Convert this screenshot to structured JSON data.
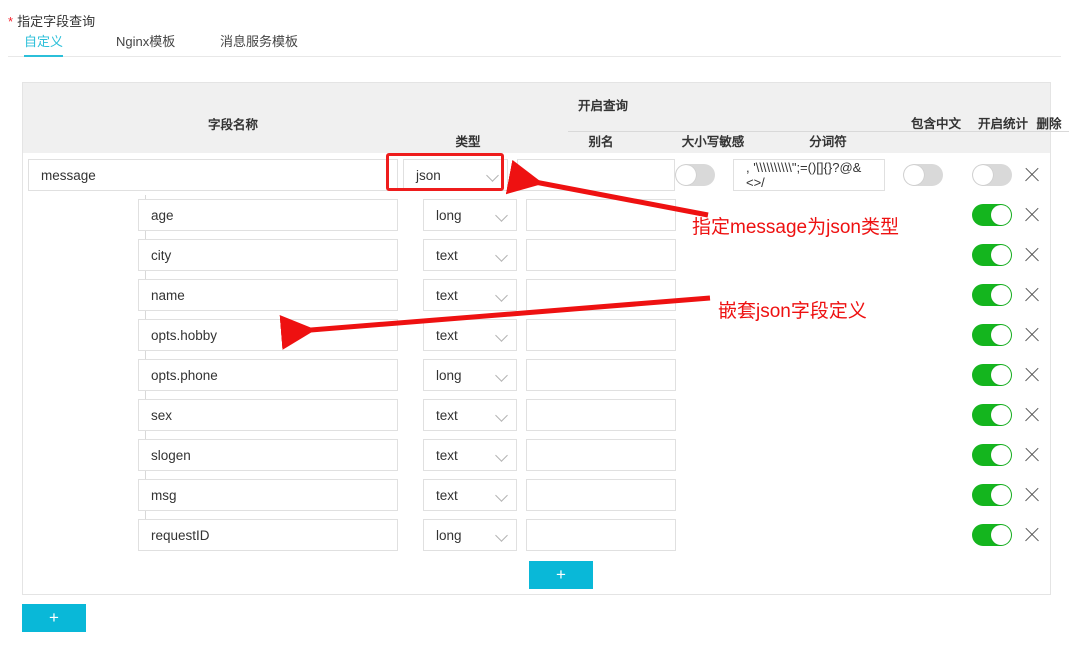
{
  "form": {
    "required_marker": "*",
    "label": "指定字段查询"
  },
  "tabs": [
    {
      "label": "自定义",
      "active": true
    },
    {
      "label": "Nginx模板",
      "active": false
    },
    {
      "label": "消息服务模板",
      "active": false
    }
  ],
  "table": {
    "headers": {
      "field_name": "字段名称",
      "group_query": "开启查询",
      "type": "类型",
      "alias": "别名",
      "case_sensitive": "大小写敏感",
      "tokenizer": "分词符",
      "contains_chinese": "包含中文",
      "enable_stats": "开启统计",
      "delete": "删除"
    },
    "root_row": {
      "name": "message",
      "type": "json",
      "alias": "",
      "case_sensitive": false,
      "tokenizer": ", '\\\\\\\\\\\\\\\\\\\\\";=()[]{}?@&<>/",
      "contains_chinese": false,
      "enable_stats": false,
      "delete_label": "×"
    },
    "child_rows": [
      {
        "name": "age",
        "type": "long",
        "alias": "",
        "enable_stats": true
      },
      {
        "name": "city",
        "type": "text",
        "alias": "",
        "enable_stats": true
      },
      {
        "name": "name",
        "type": "text",
        "alias": "",
        "enable_stats": true
      },
      {
        "name": "opts.hobby",
        "type": "text",
        "alias": "",
        "enable_stats": true
      },
      {
        "name": "opts.phone",
        "type": "long",
        "alias": "",
        "enable_stats": true
      },
      {
        "name": "sex",
        "type": "text",
        "alias": "",
        "enable_stats": true
      },
      {
        "name": "slogen",
        "type": "text",
        "alias": "",
        "enable_stats": true
      },
      {
        "name": "msg",
        "type": "text",
        "alias": "",
        "enable_stats": true
      },
      {
        "name": "requestID",
        "type": "long",
        "alias": "",
        "enable_stats": true
      }
    ]
  },
  "buttons": {
    "add_child": "+",
    "add_root": "+"
  },
  "annotations": [
    {
      "text": "指定message为json类型"
    },
    {
      "text": "嵌套json字段定义"
    }
  ],
  "colors": {
    "accent": "#2BBFD9",
    "button": "#09B8D8",
    "toggle_on": "#14b51e",
    "toggle_off": "#d9d9d9",
    "annotation": "#ee1111",
    "highlight": "#ee1c1c",
    "required": "#f5222d"
  }
}
